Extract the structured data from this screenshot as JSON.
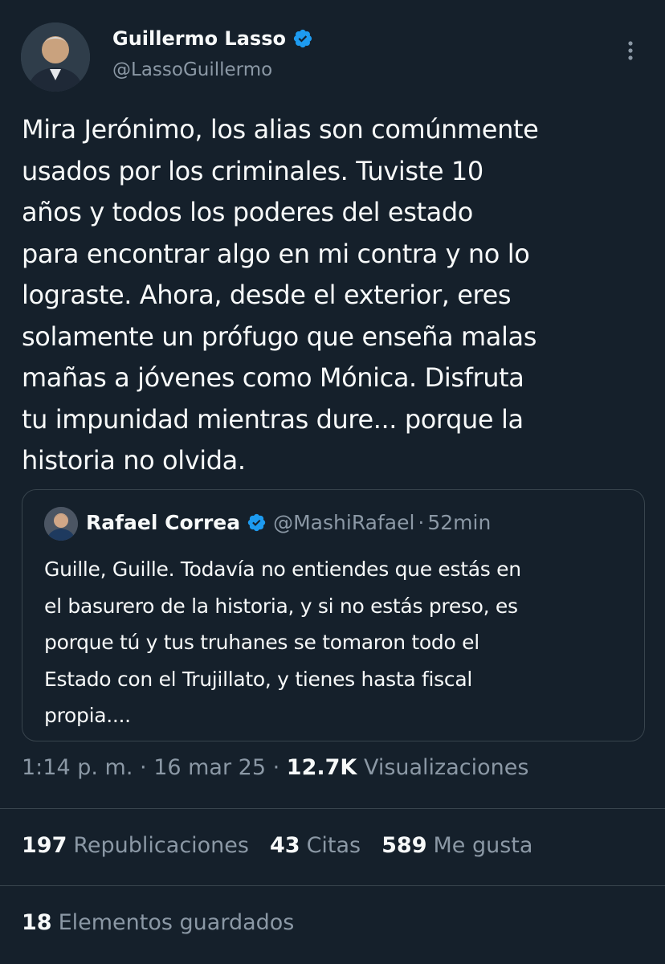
{
  "author": {
    "display_name": "Guillermo Lasso",
    "handle": "@LassoGuillermo",
    "verified": true,
    "avatar_icon": "user-avatar"
  },
  "tweet": {
    "text": "Mira Jerónimo, los alias son comúnmente\nusados por los criminales. Tuviste 10\naños y todos los poderes del estado\npara encontrar algo en mi contra y no lo\nlograste. Ahora, desde el exterior, eres\nsolamente un prófugo que enseña malas\nmañas a jóvenes como Mónica. Disfruta\ntu impunidad mientras dure... porque  la\nhistoria no olvida."
  },
  "quote": {
    "display_name": "Rafael Correa",
    "handle": "@MashiRafael",
    "separator": "·",
    "time": "52min",
    "verified": true,
    "text": "Guille, Guille. Todavía no entiendes que estás en\nel basurero de la historia, y si no estás preso, es\nporque tú y tus truhanes se tomaron todo el\nEstado con el Trujillato, y tienes hasta fiscal\npropia...."
  },
  "meta": {
    "time": "1:14 p. m.",
    "separator": "·",
    "date": "16 mar 25",
    "separator2": "·",
    "views_count": "12.7K",
    "views_label": "Visualizaciones"
  },
  "stats": {
    "reposts_count": "197",
    "reposts_label": "Republicaciones",
    "quotes_count": "43",
    "quotes_label": "Citas",
    "likes_count": "589",
    "likes_label": "Me gusta"
  },
  "saved": {
    "count": "18",
    "label": "Elementos guardados"
  },
  "colors": {
    "background": "#15202b",
    "text": "#f7f9f9",
    "secondary_text": "#8b98a5",
    "border": "#38444d",
    "verified": "#1d9bf0"
  }
}
